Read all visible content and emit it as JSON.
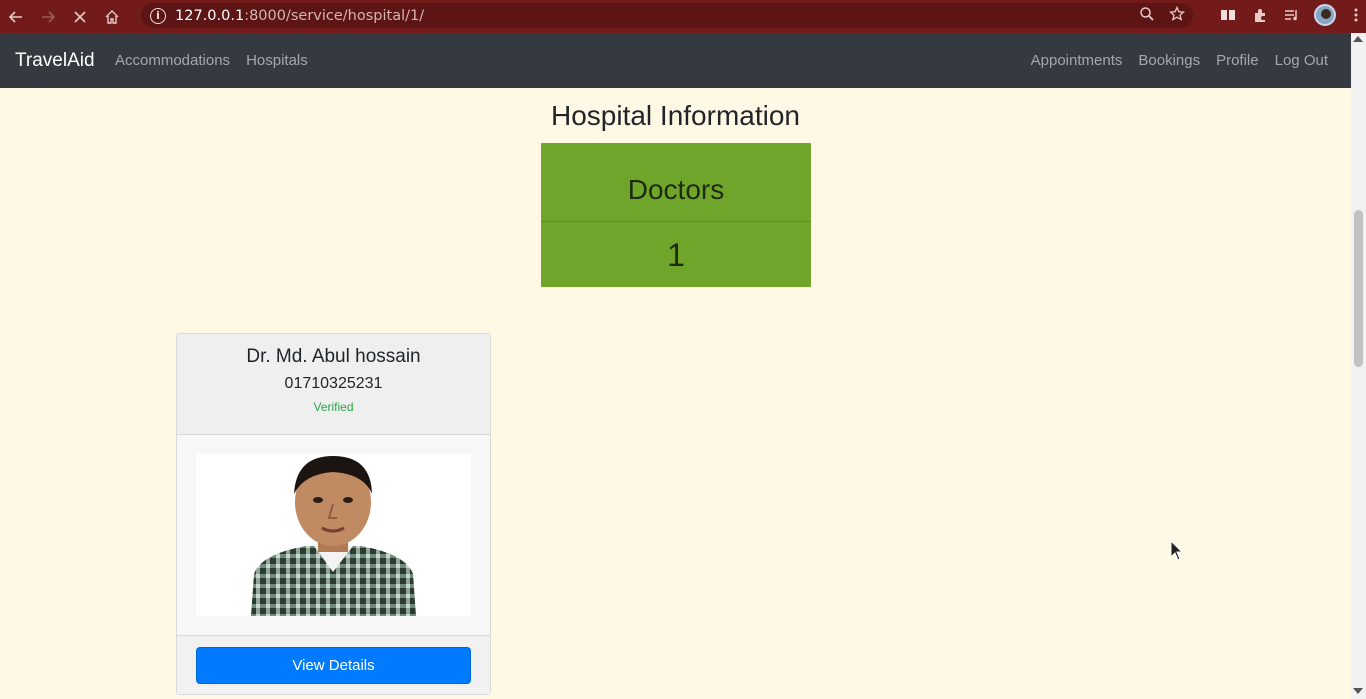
{
  "browser": {
    "url_host": "127.0.0.1",
    "url_path": ":8000/service/hospital/1/",
    "icons": [
      "back-icon",
      "forward-icon",
      "stop-icon",
      "home-icon",
      "info-icon",
      "zoom-icon",
      "star-icon",
      "reading-list-icon",
      "extensions-icon",
      "media-icon",
      "profile-avatar",
      "menu-icon"
    ]
  },
  "navbar": {
    "brand": "TravelAid",
    "left_links": [
      "Accommodations",
      "Hospitals"
    ],
    "right_links": [
      "Appointments",
      "Bookings",
      "Profile",
      "Log Out"
    ]
  },
  "page": {
    "title": "Hospital Information",
    "stat": {
      "label": "Doctors",
      "value": "1"
    }
  },
  "doctor_card": {
    "name": "Dr. Md. Abul hossain",
    "phone": "01710325231",
    "status": "Verified",
    "button_label": "View Details"
  },
  "colors": {
    "chrome": "#731b1b",
    "navbar": "#343a40",
    "page_bg": "#fff8e4",
    "stat_green": "#6fa52b",
    "verified_green": "#28a745",
    "primary_blue": "#007bff"
  }
}
